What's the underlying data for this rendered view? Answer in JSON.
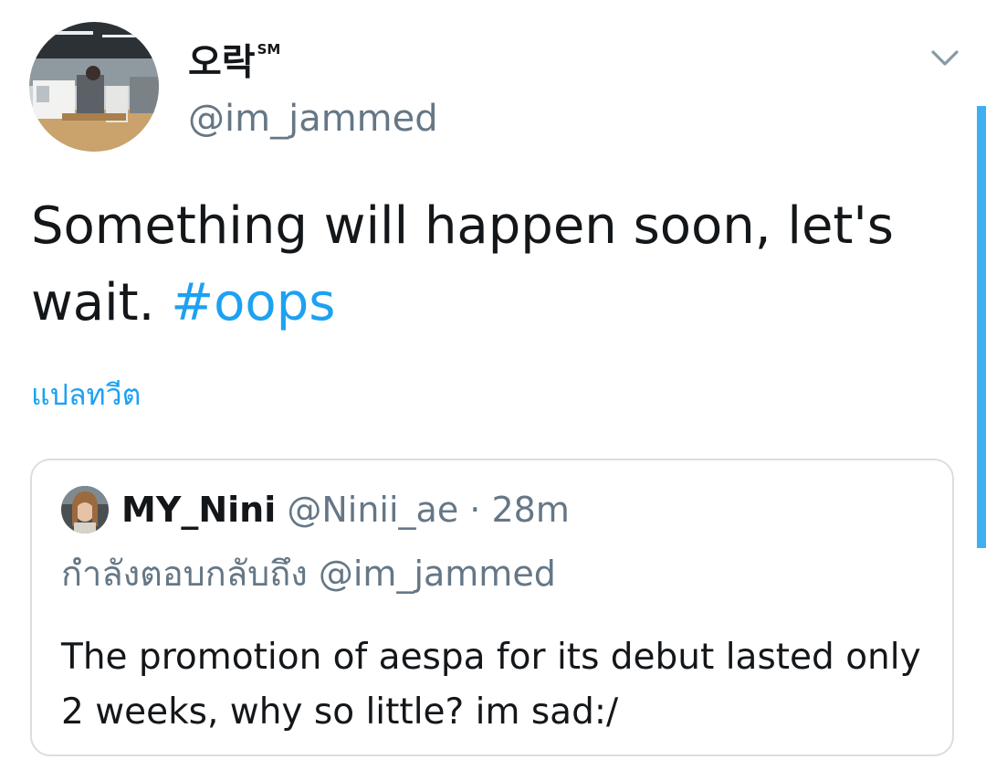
{
  "tweet": {
    "author": {
      "display_name": "오락",
      "display_name_badge": "SM",
      "handle": "@im_jammed"
    },
    "menu_icon": "chevron-down-icon",
    "text": "Something will happen soon, let's wait.",
    "hashtag": "#oops",
    "translate_label": "แปลทวีต"
  },
  "quoted_tweet": {
    "author": {
      "display_name": "MY_Nini",
      "handle": "@Ninii_ae"
    },
    "separator": "·",
    "time": "28m",
    "reply_context": "กำลังตอบกลับถึง @im_jammed",
    "text": "The promotion of aespa for its debut lasted only 2 weeks, why so little? im sad:/"
  },
  "colors": {
    "accent": "#1da1f2",
    "text_primary": "#14171a",
    "text_secondary": "#657786",
    "border": "#d8dee3"
  }
}
